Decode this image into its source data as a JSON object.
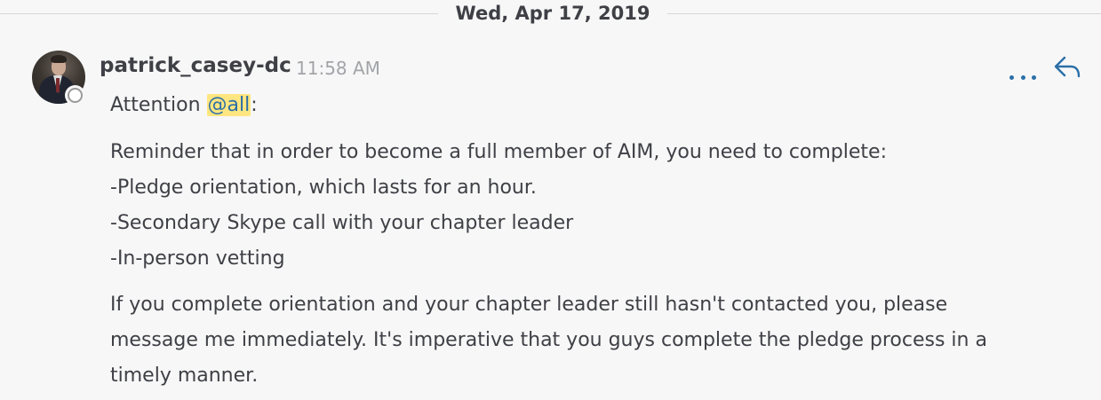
{
  "date_separator": "Wed, Apr 17, 2019",
  "message": {
    "username": "patrick_casey-dc",
    "time": "11:58 AM",
    "greeting_prefix": "Attention ",
    "mention": "@all",
    "greeting_suffix": ":",
    "lines": [
      "Reminder that in order to become a full member of AIM, you need to complete:",
      "-Pledge orientation, which lasts for an hour.",
      "-Secondary Skype call with your chapter leader",
      "-In-person vetting",
      "If you complete orientation and your chapter leader still hasn't contacted you, please",
      "message me immediately. It's imperative that you guys complete the pledge process in a",
      "timely manner."
    ]
  },
  "icons": {
    "more": "more-dots-icon",
    "reply": "reply-arrow-icon",
    "status": "offline-status-icon"
  },
  "colors": {
    "accent": "#2a6fa8",
    "mention_highlight": "#ffe680",
    "background": "#f7f7f7"
  }
}
